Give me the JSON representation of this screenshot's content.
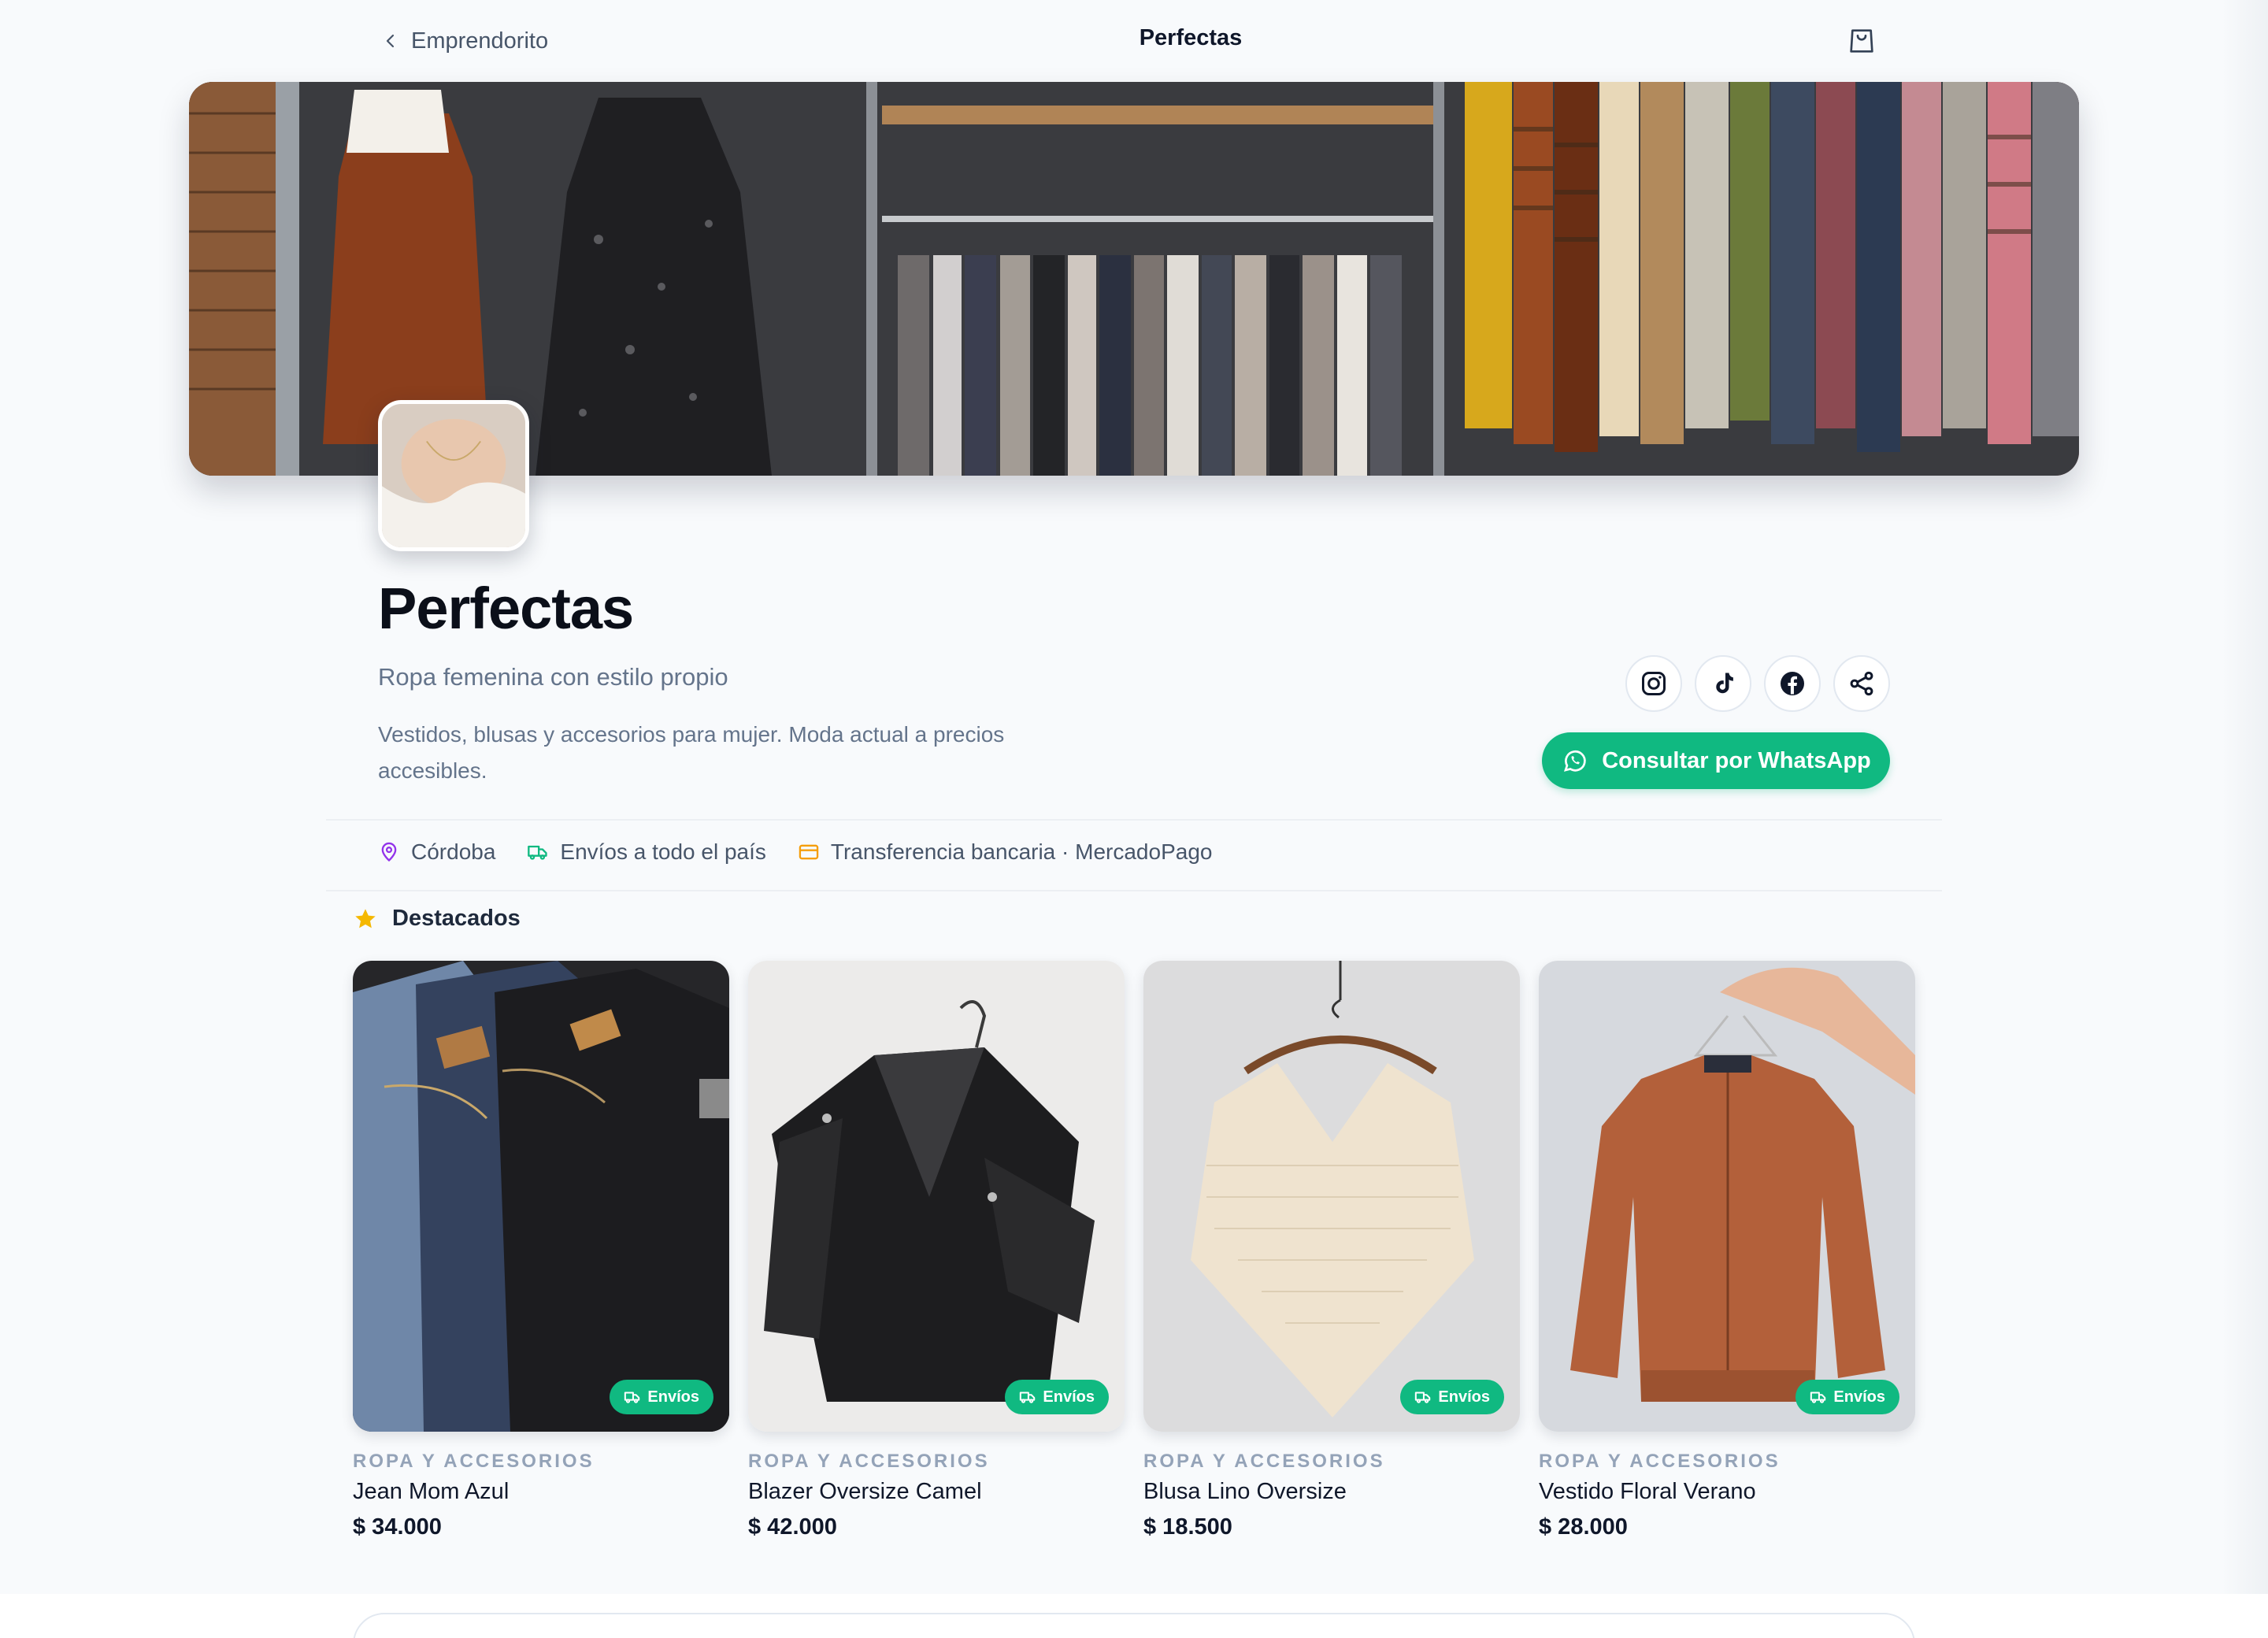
{
  "nav": {
    "back_label": "Emprendorito",
    "title": "Perfectas"
  },
  "store": {
    "name": "Perfectas",
    "tagline": "Ropa femenina con estilo propio",
    "description": "Vestidos, blusas y accesorios para mujer. Moda actual a precios accesibles.",
    "whatsapp_label": "Consultar por WhatsApp",
    "socials": [
      "instagram-icon",
      "tiktok-icon",
      "facebook-icon",
      "share-icon"
    ]
  },
  "info": {
    "location": "Córdoba",
    "shipping": "Envíos a todo el país",
    "payment": "Transferencia bancaria · MercadoPago"
  },
  "featured": {
    "title": "Destacados",
    "products": [
      {
        "category": "ROPA Y ACCESORIOS",
        "name": "Jean Mom Azul",
        "price": "$ 34.000",
        "badge": "Envíos"
      },
      {
        "category": "ROPA Y ACCESORIOS",
        "name": "Blazer Oversize Camel",
        "price": "$ 42.000",
        "badge": "Envíos"
      },
      {
        "category": "ROPA Y ACCESORIOS",
        "name": "Blusa Lino Oversize",
        "price": "$ 18.500",
        "badge": "Envíos"
      },
      {
        "category": "ROPA Y ACCESORIOS",
        "name": "Vestido Floral Verano",
        "price": "$ 28.000",
        "badge": "Envíos"
      }
    ]
  },
  "colors": {
    "accent": "#10b981",
    "location_icon": "#9333ea",
    "shipping_icon": "#10b981",
    "payment_icon": "#f59e0b",
    "star": "#f5b800"
  }
}
